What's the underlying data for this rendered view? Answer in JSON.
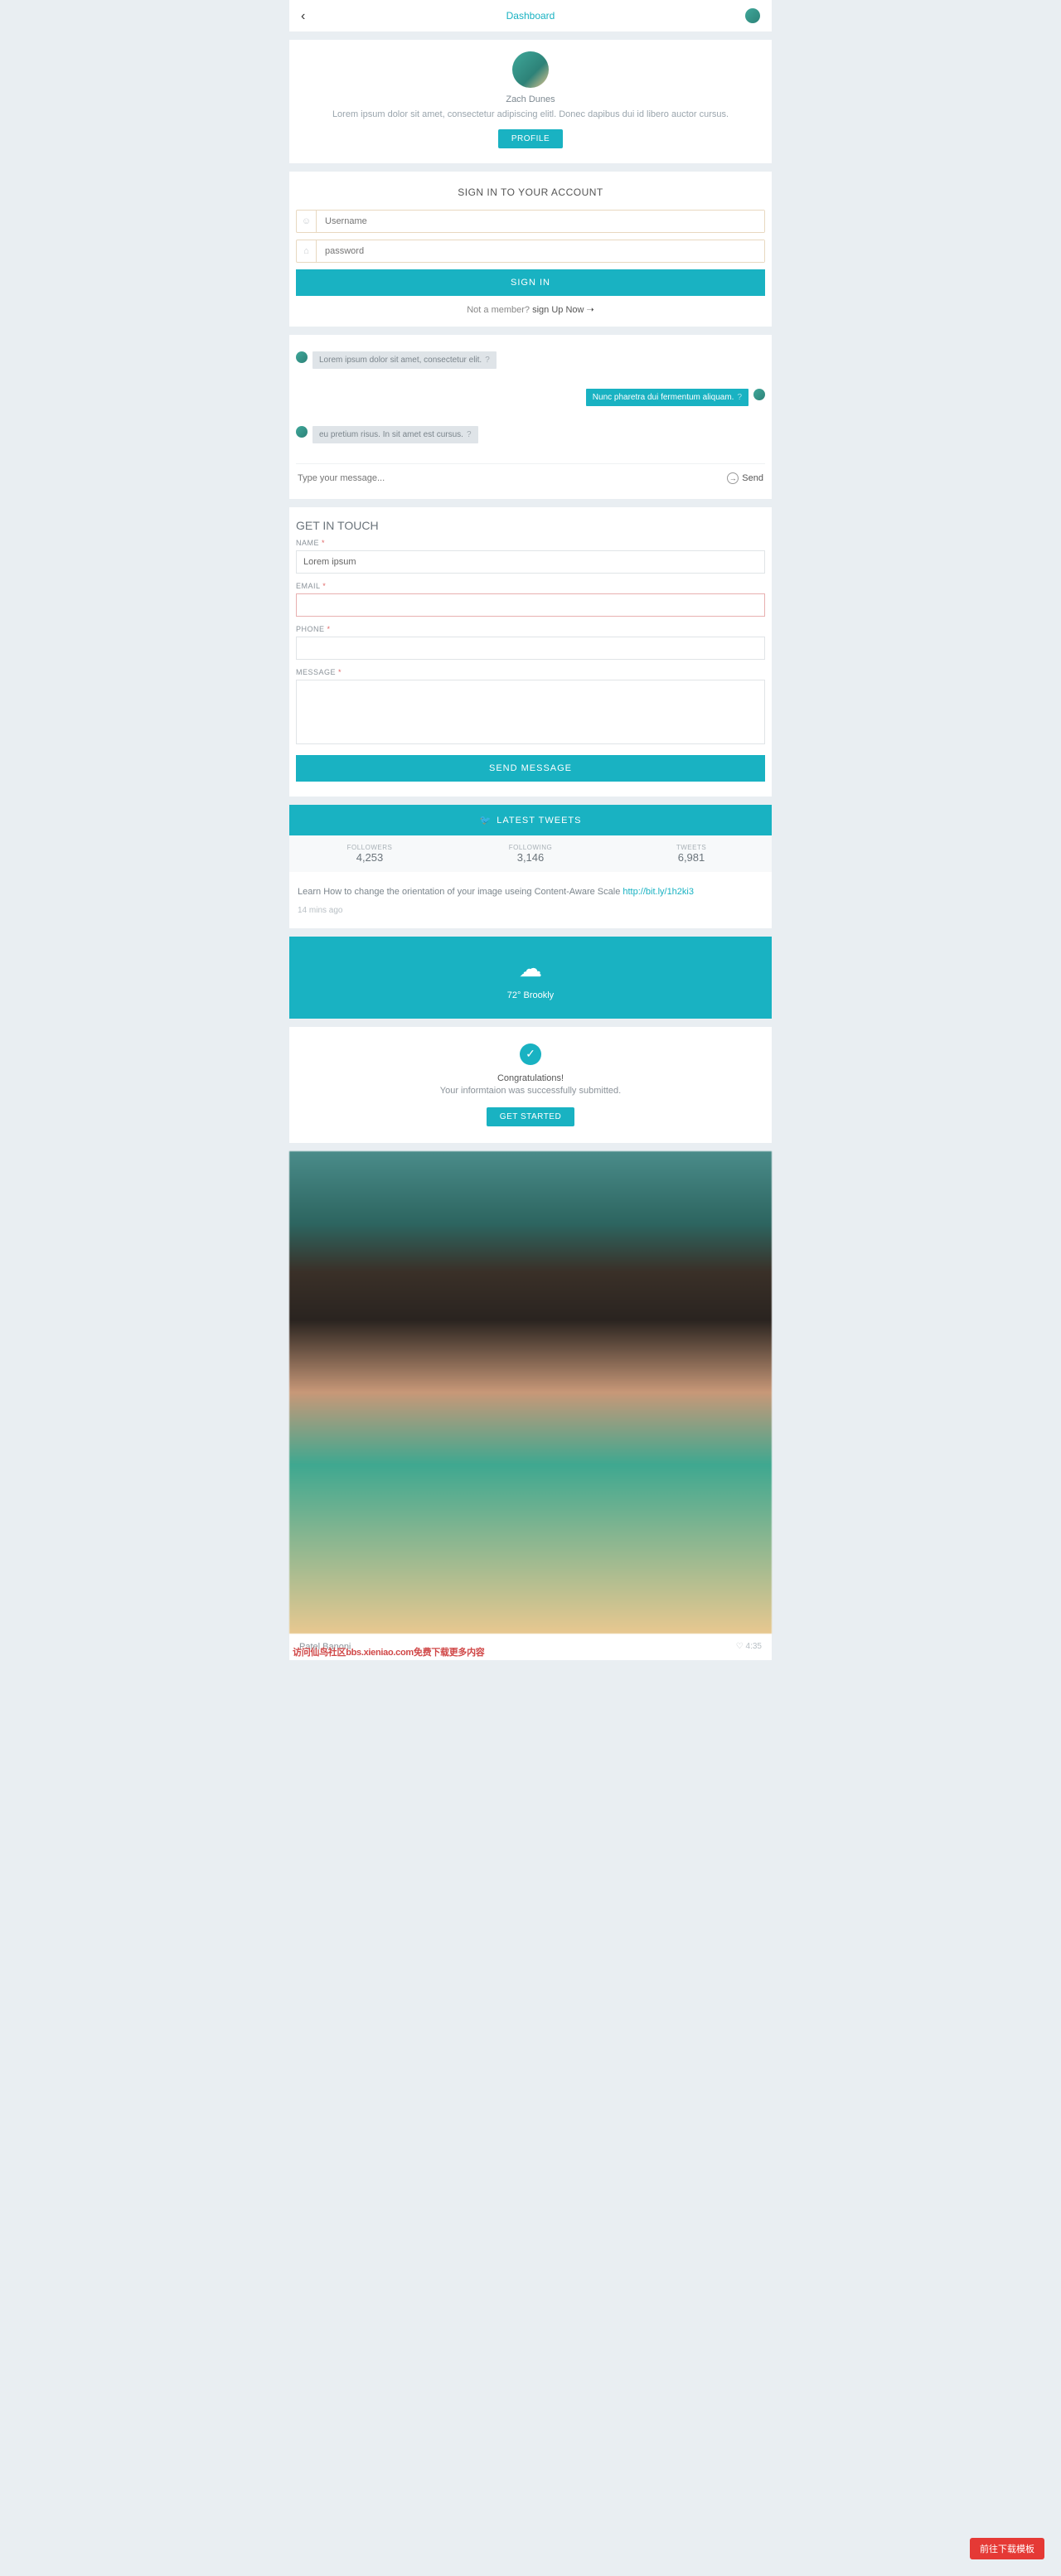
{
  "header": {
    "title": "Dashboard"
  },
  "profile": {
    "name": "Zach Dunes",
    "desc": "Lorem ipsum dolor sit amet, consectetur adipiscing elitl. Donec dapibus dui id libero auctor cursus.",
    "button": "PROFILE"
  },
  "signin": {
    "title": "SIGN IN TO YOUR ACCOUNT",
    "username_ph": "Username",
    "password_ph": "password",
    "button": "SIGN IN",
    "not_member": "Not a member? ",
    "signup": "sign Up Now ➝"
  },
  "chat": {
    "m1": "Lorem ipsum dolor sit amet, consectetur elit.",
    "m2": "Nunc pharetra dui fermentum aliquam.",
    "m3": "eu pretium risus. In sit amet est cursus.",
    "input_ph": "Type your message...",
    "send": "Send"
  },
  "contact": {
    "title": "GET IN TOUCH",
    "name_lbl": "NAME",
    "name_val": "Lorem ipsum",
    "email_lbl": "EMAIL",
    "phone_lbl": "PHONE",
    "msg_lbl": "MESSAGE",
    "button": "SEND MESSAGE"
  },
  "tweets": {
    "header": "LATEST TWEETS",
    "followers_lbl": "FOLLOWERS",
    "followers": "4,253",
    "following_lbl": "FOLLOWING",
    "following": "3,146",
    "tweets_lbl": "TWEETS",
    "tweets": "6,981",
    "text": "Learn How to change the orientation of your image useing Content-Aware Scale ",
    "link": "http://bit.ly/1h2ki3",
    "time": "14 mins ago"
  },
  "weather": {
    "temp": "72°",
    "city": "Brookly"
  },
  "success": {
    "title": "Congratulations!",
    "desc": "Your informtaion was successfully submitted.",
    "button": "GET STARTED"
  },
  "player": {
    "name": "Patel Banoni",
    "time": "4:35"
  },
  "watermark": "访问仙鸟社区bbs.xieniao.com免费下载更多内容",
  "fab": "前往下载模板"
}
